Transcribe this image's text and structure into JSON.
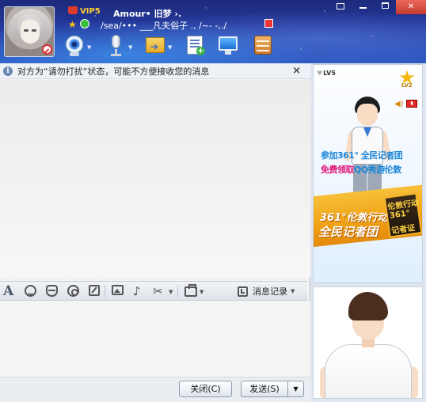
{
  "contact": {
    "vip_level": "VIP5",
    "nickname": "Amour•   旧梦 ›.",
    "signature": "/sea/•••  ___凡夫俗子   ., /~- -,./"
  },
  "window": {
    "controls": [
      "menu-icon",
      "minimize-icon",
      "maximize-icon",
      "close-icon"
    ]
  },
  "toolbar": {
    "icons": [
      "webcam-icon",
      "microphone-icon",
      "file-transfer-icon",
      "document-icon",
      "screen-share-icon",
      "app-box-icon"
    ]
  },
  "chat": {
    "notice": "对方为“请勿打扰”状态，可能不方便接收您的消息",
    "notice_close": "×",
    "history_label": "消息记录",
    "close_label": "关闭(C)",
    "send_label": "发送(S)"
  },
  "input_toolbar": {
    "icons": [
      "font-icon",
      "emoji-icon",
      "magic-emoji-icon",
      "gift-icon",
      "edit-icon",
      "image-icon",
      "music-icon",
      "scissors-icon",
      "bag-icon",
      "history-icon"
    ]
  },
  "show": {
    "lv_badge": "LV5",
    "star_level": "LV2",
    "promo_line1": "参加361° 全民记者团",
    "promo_line2_pink": "免费领取",
    "promo_line2_blue": "QQ秀游伦敦",
    "banner_line1": "361°伦敦行动",
    "banner_line2": "全民记者团",
    "sign_line1": "伦敦行动",
    "sign_line2": "361°",
    "sign_line3": "记者证"
  },
  "colors": {
    "header_dark": "#1c2a7a",
    "header_light": "#2e59c4",
    "vip_gold": "#ffcf33",
    "promo_blue": "#1a86d9",
    "promo_pink": "#e0157a",
    "banner_orange": "#f0a317"
  }
}
